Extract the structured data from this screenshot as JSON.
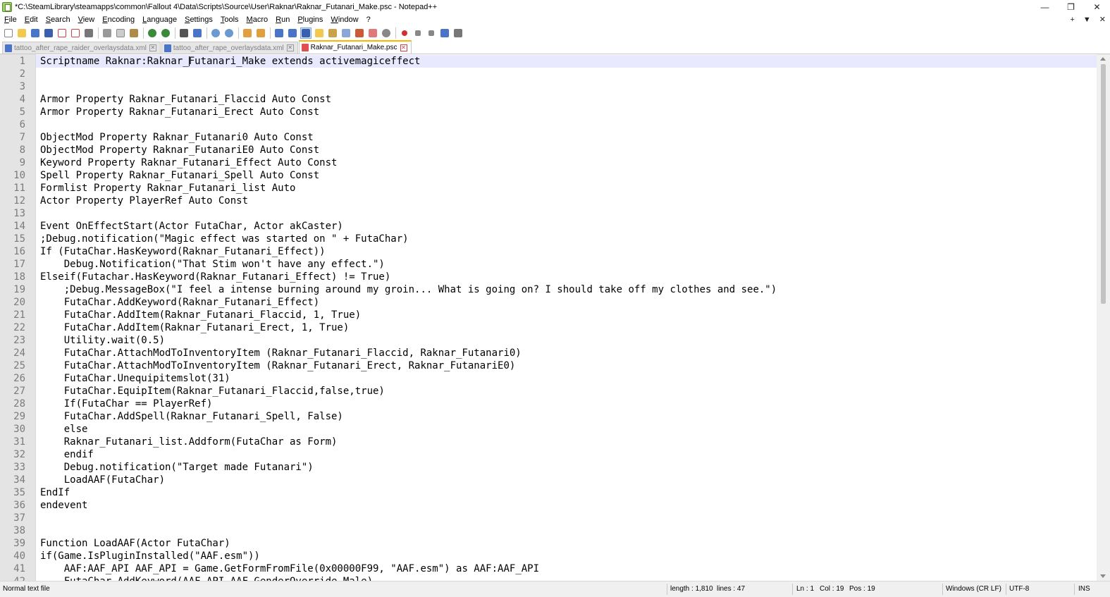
{
  "window": {
    "title": "*C:\\SteamLibrary\\steamapps\\common\\Fallout 4\\Data\\Scripts\\Source\\User\\Raknar\\Raknar_Futanari_Make.psc - Notepad++",
    "minimize": "—",
    "maximize": "❐",
    "close": "✕"
  },
  "menu": {
    "items": [
      "File",
      "Edit",
      "Search",
      "View",
      "Encoding",
      "Language",
      "Settings",
      "Tools",
      "Macro",
      "Run",
      "Plugins",
      "Window",
      "?"
    ],
    "right": {
      "plus": "+",
      "dropdown": "▼",
      "close": "✕"
    }
  },
  "tabs": [
    {
      "label": "tattoo_after_rape_raider_overlaysdata.xml",
      "active": false
    },
    {
      "label": "tattoo_after_rape_overlaysdata.xml",
      "active": false
    },
    {
      "label": "Raknar_Futanari_Make.psc",
      "active": true
    }
  ],
  "editor": {
    "current_line": 1,
    "lines": [
      {
        "n": "1",
        "text": "Scriptname Raknar:Raknar_Futanari_Make extends activemagiceffect"
      },
      {
        "n": "2",
        "text": ""
      },
      {
        "n": "3",
        "text": ""
      },
      {
        "n": "4",
        "text": "Armor Property Raknar_Futanari_Flaccid Auto Const"
      },
      {
        "n": "5",
        "text": "Armor Property Raknar_Futanari_Erect Auto Const"
      },
      {
        "n": "6",
        "text": ""
      },
      {
        "n": "7",
        "text": "ObjectMod Property Raknar_Futanari0 Auto Const"
      },
      {
        "n": "8",
        "text": "ObjectMod Property Raknar_FutanariE0 Auto Const"
      },
      {
        "n": "9",
        "text": "Keyword Property Raknar_Futanari_Effect Auto Const"
      },
      {
        "n": "10",
        "text": "Spell Property Raknar_Futanari_Spell Auto Const"
      },
      {
        "n": "11",
        "text": "Formlist Property Raknar_Futanari_list Auto"
      },
      {
        "n": "12",
        "text": "Actor Property PlayerRef Auto Const"
      },
      {
        "n": "13",
        "text": ""
      },
      {
        "n": "14",
        "text": "Event OnEffectStart(Actor FutaChar, Actor akCaster)"
      },
      {
        "n": "15",
        "text": ";Debug.notification(\"Magic effect was started on \" + FutaChar)"
      },
      {
        "n": "16",
        "text": "If (FutaChar.HasKeyword(Raknar_Futanari_Effect))"
      },
      {
        "n": "17",
        "text": "    Debug.Notification(\"That Stim won't have any effect.\")"
      },
      {
        "n": "18",
        "text": "Elseif(Futachar.HasKeyword(Raknar_Futanari_Effect) != True)"
      },
      {
        "n": "19",
        "text": "    ;Debug.MessageBox(\"I feel a intense burning around my groin... What is going on? I should take off my clothes and see.\")"
      },
      {
        "n": "20",
        "text": "    FutaChar.AddKeyword(Raknar_Futanari_Effect)"
      },
      {
        "n": "21",
        "text": "    FutaChar.AddItem(Raknar_Futanari_Flaccid, 1, True)"
      },
      {
        "n": "22",
        "text": "    FutaChar.AddItem(Raknar_Futanari_Erect, 1, True)"
      },
      {
        "n": "23",
        "text": "    Utility.wait(0.5)"
      },
      {
        "n": "24",
        "text": "    FutaChar.AttachModToInventoryItem (Raknar_Futanari_Flaccid, Raknar_Futanari0)"
      },
      {
        "n": "25",
        "text": "    FutaChar.AttachModToInventoryItem (Raknar_Futanari_Erect, Raknar_FutanariE0)"
      },
      {
        "n": "26",
        "text": "    FutaChar.Unequipitemslot(31)"
      },
      {
        "n": "27",
        "text": "    FutaChar.EquipItem(Raknar_Futanari_Flaccid,false,true)"
      },
      {
        "n": "28",
        "text": "    If(FutaChar == PlayerRef)"
      },
      {
        "n": "29",
        "text": "    FutaChar.AddSpell(Raknar_Futanari_Spell, False)"
      },
      {
        "n": "30",
        "text": "    else"
      },
      {
        "n": "31",
        "text": "    Raknar_Futanari_list.Addform(FutaChar as Form)"
      },
      {
        "n": "32",
        "text": "    endif"
      },
      {
        "n": "33",
        "text": "    Debug.notification(\"Target made Futanari\")"
      },
      {
        "n": "34",
        "text": "    LoadAAF(FutaChar)"
      },
      {
        "n": "35",
        "text": "EndIf"
      },
      {
        "n": "36",
        "text": "endevent"
      },
      {
        "n": "37",
        "text": ""
      },
      {
        "n": "38",
        "text": ""
      },
      {
        "n": "39",
        "text": "Function LoadAAF(Actor FutaChar)"
      },
      {
        "n": "40",
        "text": "if(Game.IsPluginInstalled(\"AAF.esm\"))"
      },
      {
        "n": "41",
        "text": "    AAF:AAF_API AAF_API = Game.GetFormFromFile(0x00000F99, \"AAF.esm\") as AAF:AAF_API"
      },
      {
        "n": "42",
        "text": "    FutaChar.AddKeyword(AAF_API.AAF_GenderOverride_Male)"
      }
    ]
  },
  "status": {
    "file_type": "Normal text file",
    "length": "length : 1,810",
    "lines": "lines : 47",
    "ln": "Ln : 1",
    "col": "Col : 19",
    "pos": "Pos : 19",
    "eol": "Windows (CR LF)",
    "encoding": "UTF-8",
    "mode": "INS"
  }
}
